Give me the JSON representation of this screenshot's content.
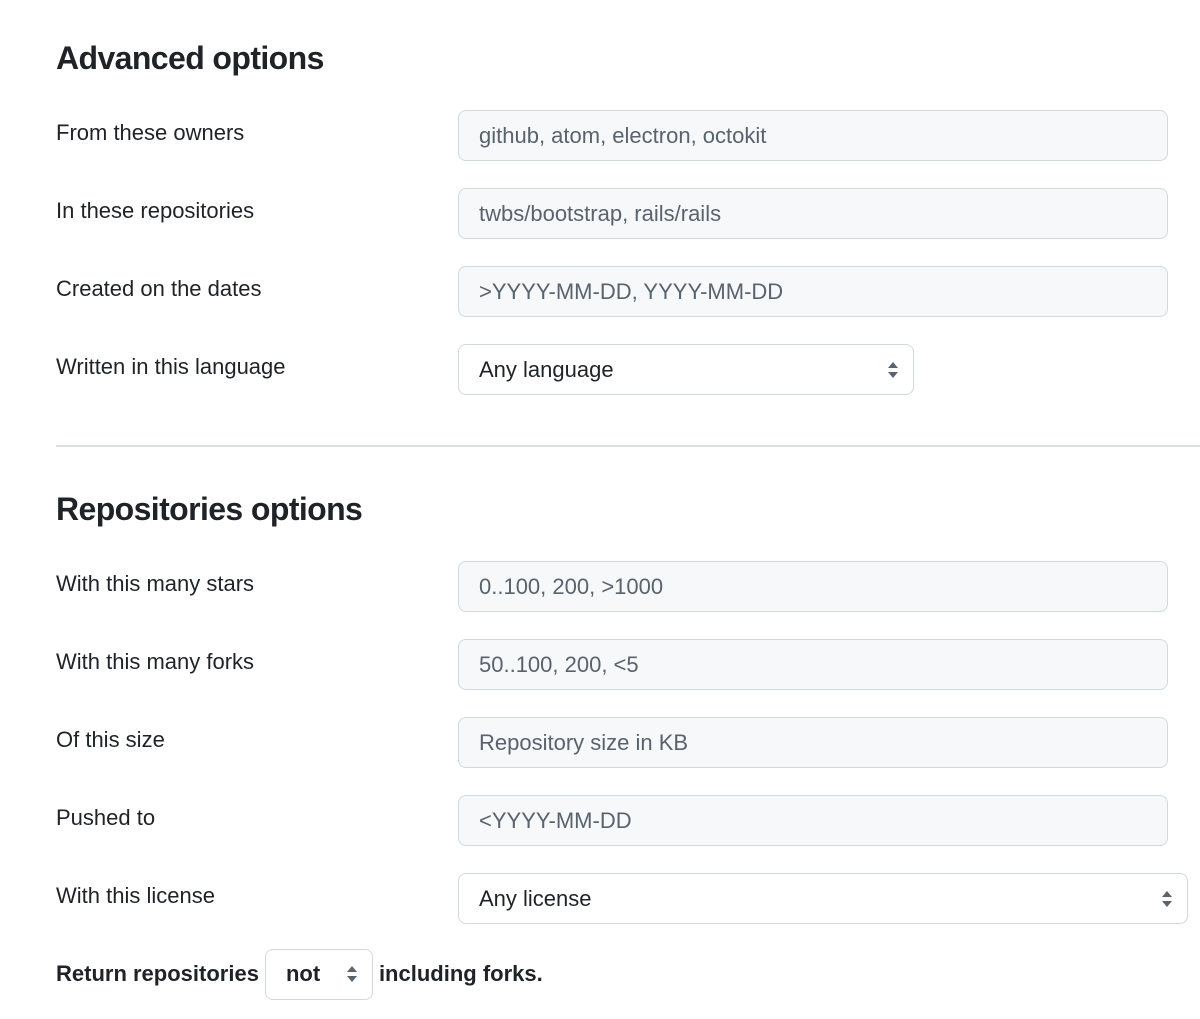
{
  "advanced": {
    "title": "Advanced options",
    "owners": {
      "label": "From these owners",
      "placeholder": "github, atom, electron, octokit"
    },
    "repos": {
      "label": "In these repositories",
      "placeholder": "twbs/bootstrap, rails/rails"
    },
    "dates": {
      "label": "Created on the dates",
      "placeholder": ">YYYY-MM-DD, YYYY-MM-DD"
    },
    "language": {
      "label": "Written in this language",
      "selected": "Any language"
    }
  },
  "repositories": {
    "title": "Repositories options",
    "stars": {
      "label": "With this many stars",
      "placeholder": "0..100, 200, >1000"
    },
    "forks": {
      "label": "With this many forks",
      "placeholder": "50..100, 200, <5"
    },
    "size": {
      "label": "Of this size",
      "placeholder": "Repository size in KB"
    },
    "pushed": {
      "label": "Pushed to",
      "placeholder": "<YYYY-MM-DD"
    },
    "license": {
      "label": "With this license",
      "selected": "Any license"
    },
    "forks_filter": {
      "prefix": "Return repositories",
      "selected": "not",
      "suffix": "including forks."
    }
  },
  "icons": {
    "select_arrow": "updown-arrows-icon"
  },
  "colors": {
    "text": "#1f2328",
    "placeholder": "#59636e",
    "input_bg": "#f6f8fa",
    "border": "#d1d9e0"
  }
}
